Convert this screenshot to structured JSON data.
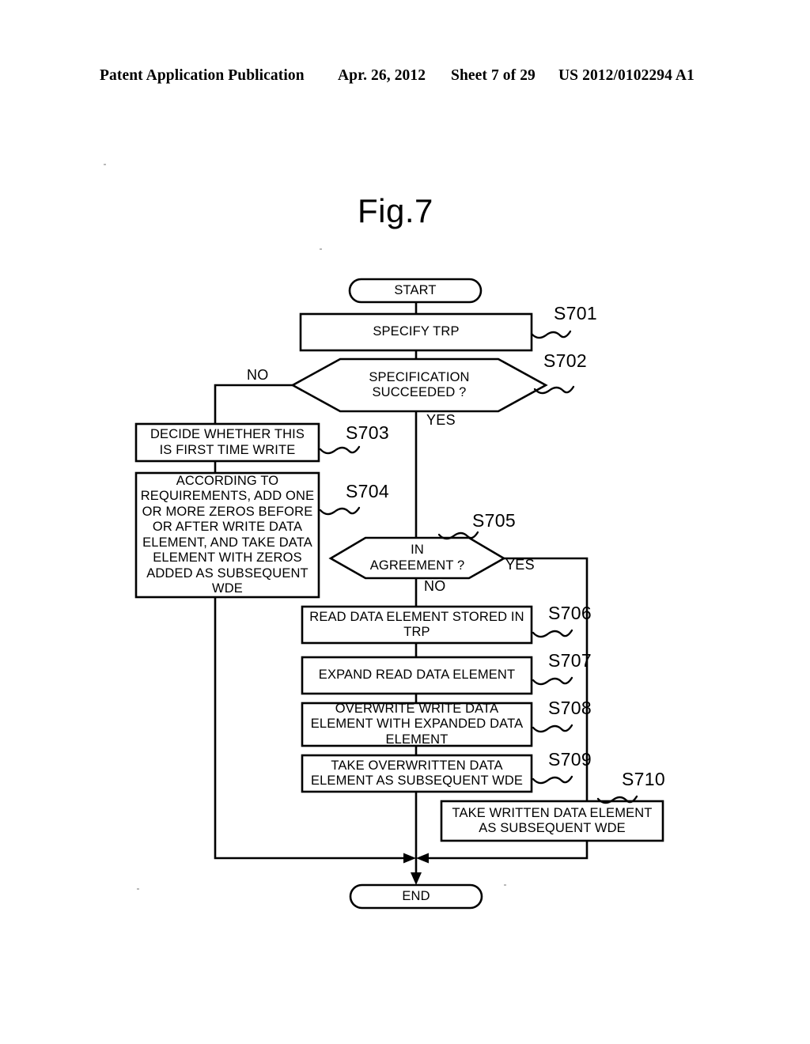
{
  "page": {
    "header": {
      "publication": "Patent Application Publication",
      "date": "Apr. 26, 2012",
      "sheet": "Sheet 7 of 29",
      "number": "US 2012/0102294 A1"
    },
    "figure_title": "Fig.7"
  },
  "flowchart": {
    "nodes": [
      {
        "id": "start",
        "shape": "terminator",
        "text": "START"
      },
      {
        "id": "s701",
        "shape": "process",
        "text": "SPECIFY TRP"
      },
      {
        "id": "s702",
        "shape": "decision",
        "text": "SPECIFICATION\nSUCCEEDED ?"
      },
      {
        "id": "s703",
        "shape": "process",
        "text": "DECIDE WHETHER THIS\nIS FIRST TIME WRITE"
      },
      {
        "id": "s704",
        "shape": "process",
        "text": "ACCORDING TO\nREQUIREMENTS, ADD ONE\nOR MORE ZEROS BEFORE\nOR AFTER WRITE DATA\nELEMENT, AND TAKE DATA\nELEMENT WITH ZEROS\nADDED AS SUBSEQUENT\nWDE"
      },
      {
        "id": "s705",
        "shape": "decision",
        "text": "IN\nAGREEMENT ?"
      },
      {
        "id": "s706",
        "shape": "process",
        "text": "READ DATA ELEMENT STORED IN\nTRP"
      },
      {
        "id": "s707",
        "shape": "process",
        "text": "EXPAND READ DATA ELEMENT"
      },
      {
        "id": "s708",
        "shape": "process",
        "text": "OVERWRITE WRITE DATA\nELEMENT WITH EXPANDED DATA\nELEMENT"
      },
      {
        "id": "s709",
        "shape": "process",
        "text": "TAKE OVERWRITTEN DATA\nELEMENT AS SUBSEQUENT WDE"
      },
      {
        "id": "s710",
        "shape": "process",
        "text": "TAKE WRITTEN DATA ELEMENT\nAS SUBSEQUENT WDE"
      },
      {
        "id": "end",
        "shape": "terminator",
        "text": "END"
      }
    ],
    "step_labels": [
      {
        "id": "s701",
        "text": "S701"
      },
      {
        "id": "s702",
        "text": "S702"
      },
      {
        "id": "s703",
        "text": "S703"
      },
      {
        "id": "s704",
        "text": "S704"
      },
      {
        "id": "s705",
        "text": "S705"
      },
      {
        "id": "s706",
        "text": "S706"
      },
      {
        "id": "s707",
        "text": "S707"
      },
      {
        "id": "s708",
        "text": "S708"
      },
      {
        "id": "s709",
        "text": "S709"
      },
      {
        "id": "s710",
        "text": "S710"
      }
    ],
    "branch_labels": [
      {
        "id": "s702-no",
        "text": "NO"
      },
      {
        "id": "s702-yes",
        "text": "YES"
      },
      {
        "id": "s705-no",
        "text": "NO"
      },
      {
        "id": "s705-yes",
        "text": "YES"
      }
    ],
    "colors": {
      "stroke": "#000000",
      "fill": "#ffffff",
      "text": "#000000"
    }
  }
}
